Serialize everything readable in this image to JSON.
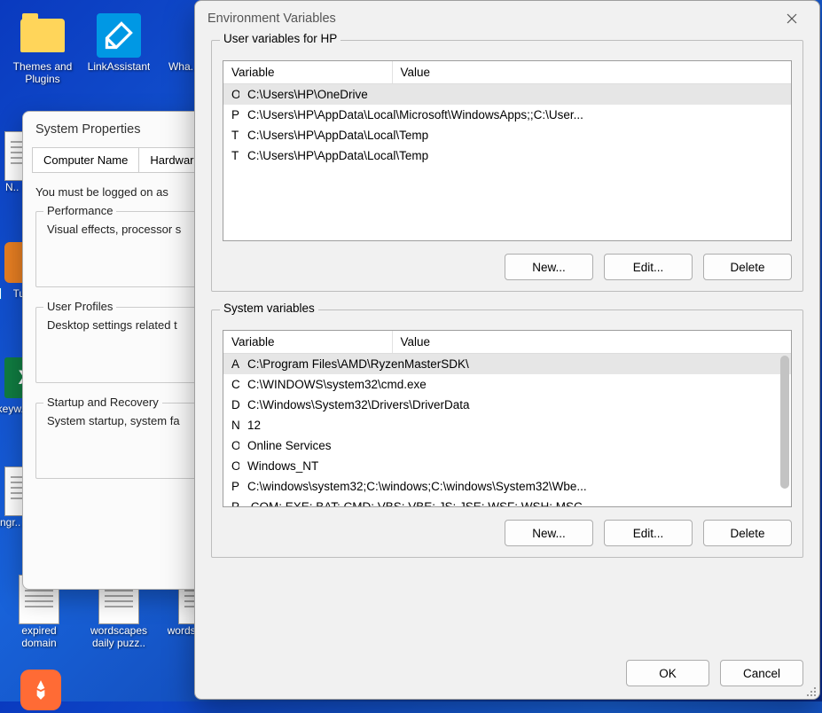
{
  "desktop": {
    "icons": [
      {
        "label": "Themes and Plugins"
      },
      {
        "label": "LinkAssistant"
      },
      {
        "label": "Wha.. Imag.."
      },
      {
        "label": "N.. Mic.."
      },
      {
        "label": "Turl.."
      },
      {
        "label": "keyw.. ingr.."
      },
      {
        "label": "ingr.. chec.."
      },
      {
        "label": "expired domain"
      },
      {
        "label": "wordscapes daily puzz.."
      },
      {
        "label": "wordsc.. dai.."
      }
    ]
  },
  "sysprops": {
    "title": "System Properties",
    "tabs": {
      "tab1": "Computer Name",
      "tab2": "Hardware"
    },
    "note": "You must be logged on as",
    "groups": {
      "perf": {
        "legend": "Performance",
        "text": "Visual effects, processor s"
      },
      "profiles": {
        "legend": "User Profiles",
        "text": "Desktop settings related t"
      },
      "startup": {
        "legend": "Startup and Recovery",
        "text": "System startup, system fa"
      }
    }
  },
  "env": {
    "title": "Environment Variables",
    "user_legend": "User variables for HP",
    "sys_legend": "System variables",
    "headers": {
      "var": "Variable",
      "val": "Value"
    },
    "user_vars": [
      {
        "name": "OneDrive",
        "value": "C:\\Users\\HP\\OneDrive"
      },
      {
        "name": "Path",
        "value": "C:\\Users\\HP\\AppData\\Local\\Microsoft\\WindowsApps;;C:\\User..."
      },
      {
        "name": "TEMP",
        "value": "C:\\Users\\HP\\AppData\\Local\\Temp"
      },
      {
        "name": "TMP",
        "value": "C:\\Users\\HP\\AppData\\Local\\Temp"
      }
    ],
    "sys_vars": [
      {
        "name": "AMDRMSDKPATH",
        "value": "C:\\Program Files\\AMD\\RyzenMasterSDK\\"
      },
      {
        "name": "ComSpec",
        "value": "C:\\WINDOWS\\system32\\cmd.exe"
      },
      {
        "name": "DriverData",
        "value": "C:\\Windows\\System32\\Drivers\\DriverData"
      },
      {
        "name": "NUMBER_OF_PROCESSORS",
        "value": "12"
      },
      {
        "name": "OnlineServices",
        "value": "Online Services"
      },
      {
        "name": "OS",
        "value": "Windows_NT"
      },
      {
        "name": "Path",
        "value": "C:\\windows\\system32;C:\\windows;C:\\windows\\System32\\Wbe..."
      },
      {
        "name": "PATHEXT",
        "value": ".COM;.EXE;.BAT;.CMD;.VBS;.VBE;.JS;.JSE;.WSF;.WSH;.MSC"
      }
    ],
    "buttons": {
      "new": "New...",
      "edit": "Edit...",
      "delete": "Delete",
      "ok": "OK",
      "cancel": "Cancel"
    }
  }
}
